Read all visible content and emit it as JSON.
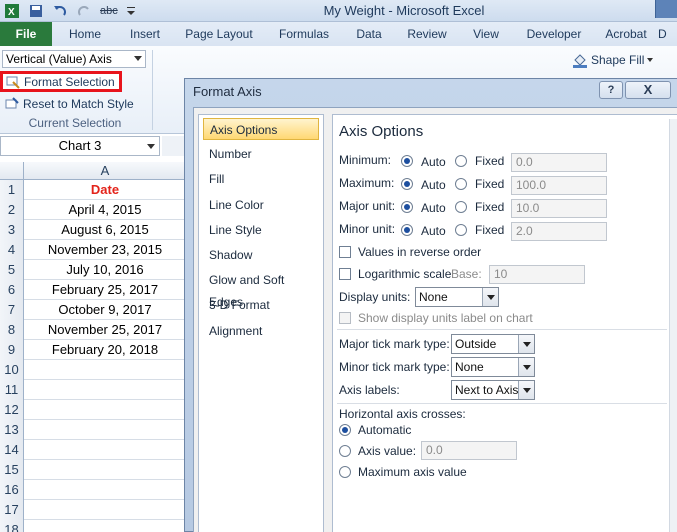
{
  "window": {
    "title": "My Weight - Microsoft Excel"
  },
  "qat": {
    "icons": [
      "excel-icon",
      "save-icon",
      "undo-icon",
      "redo-icon",
      "spelling-icon",
      "customize-icon"
    ],
    "spelling_label": "abc"
  },
  "ribbon_tabs": [
    "File",
    "Home",
    "Insert",
    "Page Layout",
    "Formulas",
    "Data",
    "Review",
    "View",
    "Developer",
    "Acrobat",
    "D"
  ],
  "ribbon": {
    "element_selector": "Vertical (Value) Axis",
    "format_selection": "Format Selection",
    "reset_style": "Reset to Match Style",
    "group_label": "Current Selection",
    "shape_fill": "Shape Fill"
  },
  "namebox": "Chart 3",
  "sheet": {
    "column_header": "A",
    "rows": [
      {
        "num": "1",
        "value": "Date"
      },
      {
        "num": "2",
        "value": "April 4, 2015"
      },
      {
        "num": "3",
        "value": "August 6, 2015"
      },
      {
        "num": "4",
        "value": "November 23, 2015"
      },
      {
        "num": "5",
        "value": "July 10, 2016"
      },
      {
        "num": "6",
        "value": "February 25, 2017"
      },
      {
        "num": "7",
        "value": "October 9, 2017"
      },
      {
        "num": "8",
        "value": "November 25, 2017"
      },
      {
        "num": "9",
        "value": "February 20, 2018"
      },
      {
        "num": "10",
        "value": ""
      },
      {
        "num": "11",
        "value": ""
      },
      {
        "num": "12",
        "value": ""
      },
      {
        "num": "13",
        "value": ""
      },
      {
        "num": "14",
        "value": ""
      },
      {
        "num": "15",
        "value": ""
      },
      {
        "num": "16",
        "value": ""
      },
      {
        "num": "17",
        "value": ""
      },
      {
        "num": "18",
        "value": ""
      }
    ]
  },
  "dialog": {
    "title": "Format Axis",
    "help": "?",
    "close": "X",
    "categories": [
      "Axis Options",
      "Number",
      "Fill",
      "Line Color",
      "Line Style",
      "Shadow",
      "Glow and Soft Edges",
      "3-D Format",
      "Alignment"
    ],
    "selected_category": "Axis Options",
    "panel": {
      "title": "Axis Options",
      "auto_label": "Auto",
      "fixed_label": "Fixed",
      "minimum": {
        "label": "Minimum:",
        "value": "0.0"
      },
      "maximum": {
        "label": "Maximum:",
        "value": "100.0"
      },
      "major_unit": {
        "label": "Major unit:",
        "value": "10.0"
      },
      "minor_unit": {
        "label": "Minor unit:",
        "value": "2.0"
      },
      "reverse_order": "Values in reverse order",
      "log_scale": "Logarithmic scale",
      "base_label": "Base:",
      "base_value": "10",
      "display_units_label": "Display units:",
      "display_units_value": "None",
      "show_units_label": "Show display units label on chart",
      "major_tick_label": "Major tick mark type:",
      "major_tick_value": "Outside",
      "minor_tick_label": "Minor tick mark type:",
      "minor_tick_value": "None",
      "axis_labels_label": "Axis labels:",
      "axis_labels_value": "Next to Axis",
      "crosses_label": "Horizontal axis crosses:",
      "crosses_automatic": "Automatic",
      "crosses_axis_value": "Axis value:",
      "crosses_axis_value_input": "0.0",
      "crosses_max": "Maximum axis value"
    }
  }
}
